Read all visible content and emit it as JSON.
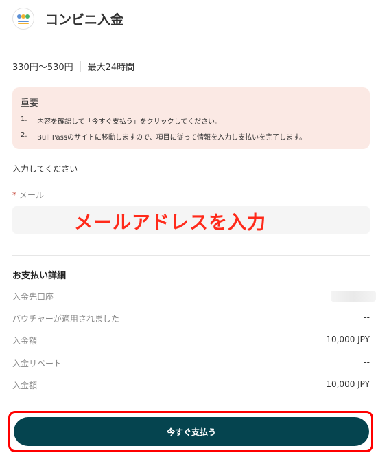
{
  "header": {
    "title": "コンビニ入金",
    "logo_icon": "bank-logo-icon",
    "logo_colors": [
      "#5b8fd6",
      "#f2b233",
      "#48b36a",
      "#e24a4a"
    ]
  },
  "info": {
    "fee": "330円～530円",
    "time": "最大24時間"
  },
  "notice": {
    "title": "重要",
    "items": [
      {
        "num": "1.",
        "text": "内容を確認して「今すぐ支払う」をクリックしてください。"
      },
      {
        "num": "2.",
        "text": "Bull Passのサイトに移動しますので、項目に従って情報を入力し支払いを完了します。"
      }
    ],
    "background": "#fbe9e4"
  },
  "form": {
    "prompt": "入力してください",
    "required_mark": "*",
    "email_label": "メール",
    "email_value": "",
    "overlay_annotation": "メールアドレスを入力"
  },
  "details": {
    "title": "お支払い詳細",
    "rows": [
      {
        "label": "入金先口座",
        "value": ""
      },
      {
        "label": "バウチャーが適用されました",
        "value": "--"
      },
      {
        "label": "入金額",
        "value": "10,000 JPY"
      },
      {
        "label": "入金リベート",
        "value": "--"
      },
      {
        "label": "入金額",
        "value": "10,000 JPY"
      }
    ]
  },
  "actions": {
    "pay_label": "今すぐ支払う",
    "pay_color": "#05444f",
    "highlight_color": "#ff0000"
  }
}
